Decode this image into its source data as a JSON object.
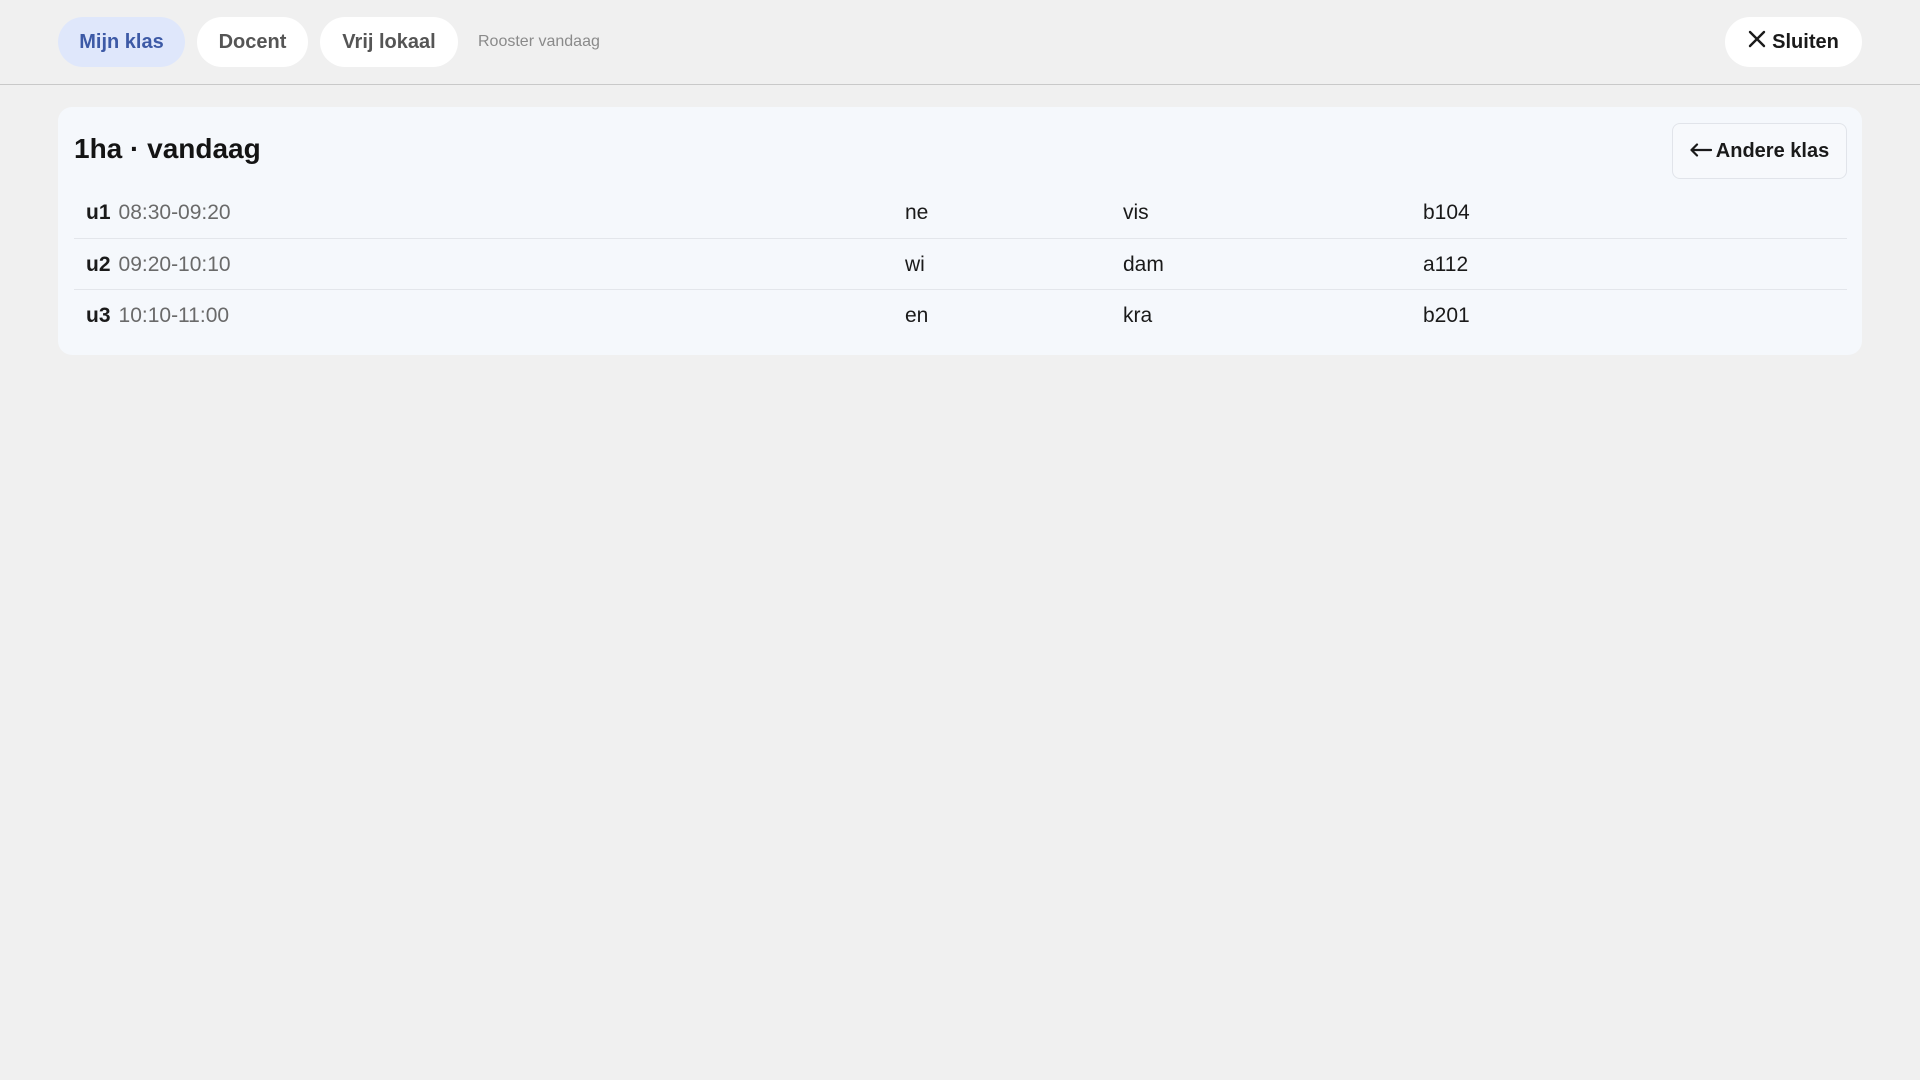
{
  "header": {
    "tabs": [
      {
        "label": "Mijn klas",
        "active": true
      },
      {
        "label": "Docent",
        "active": false
      },
      {
        "label": "Vrij lokaal",
        "active": false
      }
    ],
    "subtitle": "Rooster vandaag",
    "close_label": "Sluiten"
  },
  "card": {
    "title": "1ha · vandaag",
    "back_label": "Andere klas",
    "rows": [
      {
        "period": "u1",
        "time": "08:30-09:20",
        "subject": "ne",
        "teacher": "vis",
        "room": "b104"
      },
      {
        "period": "u2",
        "time": "09:20-10:10",
        "subject": "wi",
        "teacher": "dam",
        "room": "a112"
      },
      {
        "period": "u3",
        "time": "10:10-11:00",
        "subject": "en",
        "teacher": "kra",
        "room": "b201"
      }
    ]
  },
  "colors": {
    "background": "#f0f0f0",
    "active_tab_bg": "#dfe7fb",
    "active_tab_text": "#3d5aa6",
    "card_bg": "#f5f8fc"
  },
  "icons": {
    "close": "close-icon",
    "back": "arrow-left-icon"
  }
}
